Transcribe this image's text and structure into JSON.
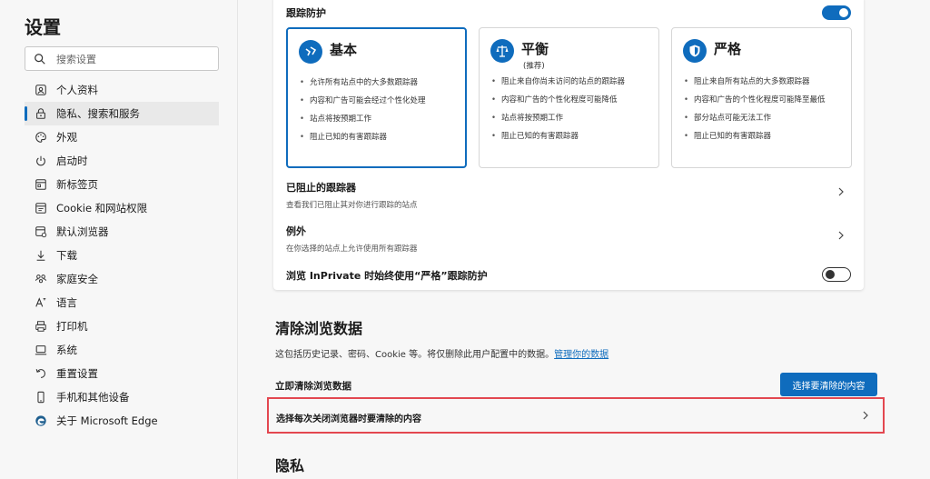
{
  "sidebar": {
    "title": "设置",
    "search_placeholder": "搜索设置",
    "items": [
      {
        "label": "个人资料",
        "icon": "profile-icon"
      },
      {
        "label": "隐私、搜索和服务",
        "icon": "lock-icon",
        "active": true
      },
      {
        "label": "外观",
        "icon": "appearance-icon"
      },
      {
        "label": "启动时",
        "icon": "power-icon"
      },
      {
        "label": "新标签页",
        "icon": "new-tab-icon"
      },
      {
        "label": "Cookie 和网站权限",
        "icon": "site-permissions-icon"
      },
      {
        "label": "默认浏览器",
        "icon": "default-browser-icon"
      },
      {
        "label": "下载",
        "icon": "download-icon"
      },
      {
        "label": "家庭安全",
        "icon": "family-icon"
      },
      {
        "label": "语言",
        "icon": "language-icon"
      },
      {
        "label": "打印机",
        "icon": "printer-icon"
      },
      {
        "label": "系统",
        "icon": "system-icon"
      },
      {
        "label": "重置设置",
        "icon": "reset-icon"
      },
      {
        "label": "手机和其他设备",
        "icon": "phone-icon"
      },
      {
        "label": "关于 Microsoft Edge",
        "icon": "edge-icon"
      }
    ]
  },
  "tracking": {
    "title": "跟踪防护",
    "enabled": true,
    "levels": [
      {
        "name": "基本",
        "subtitle": "",
        "icon": "basic-icon",
        "selected": true,
        "bullets": [
          "允许所有站点中的大多数跟踪器",
          "内容和广告可能会经过个性化处理",
          "站点将按预期工作",
          "阻止已知的有害跟踪器"
        ]
      },
      {
        "name": "平衡",
        "subtitle": "(推荐)",
        "icon": "balance-icon",
        "selected": false,
        "bullets": [
          "阻止来自你尚未访问的站点的跟踪器",
          "内容和广告的个性化程度可能降低",
          "站点将按预期工作",
          "阻止已知的有害跟踪器"
        ]
      },
      {
        "name": "严格",
        "subtitle": "",
        "icon": "shield-icon",
        "selected": false,
        "bullets": [
          "阻止来自所有站点的大多数跟踪器",
          "内容和广告的个性化程度可能降至最低",
          "部分站点可能无法工作",
          "阻止已知的有害跟踪器"
        ]
      }
    ],
    "blocked": {
      "title": "已阻止的跟踪器",
      "desc": "查看我们已阻止其对你进行跟踪的站点"
    },
    "exceptions": {
      "title": "例外",
      "desc": "在你选择的站点上允许使用所有跟踪器"
    },
    "inprivate": {
      "title": "浏览 InPrivate 时始终使用“严格”跟踪防护",
      "enabled": false
    }
  },
  "clear_data": {
    "title": "清除浏览数据",
    "desc": "这包括历史记录、密码、Cookie 等。将仅删除此用户配置中的数据。",
    "manage_link": "管理你的数据",
    "clear_now_label": "立即清除浏览数据",
    "choose_button": "选择要清除的内容",
    "on_close_label": "选择每次关闭浏览器时要清除的内容"
  },
  "privacy": {
    "title": "隐私"
  },
  "colors": {
    "accent": "#0f6cbd",
    "highlight": "#e34750"
  }
}
